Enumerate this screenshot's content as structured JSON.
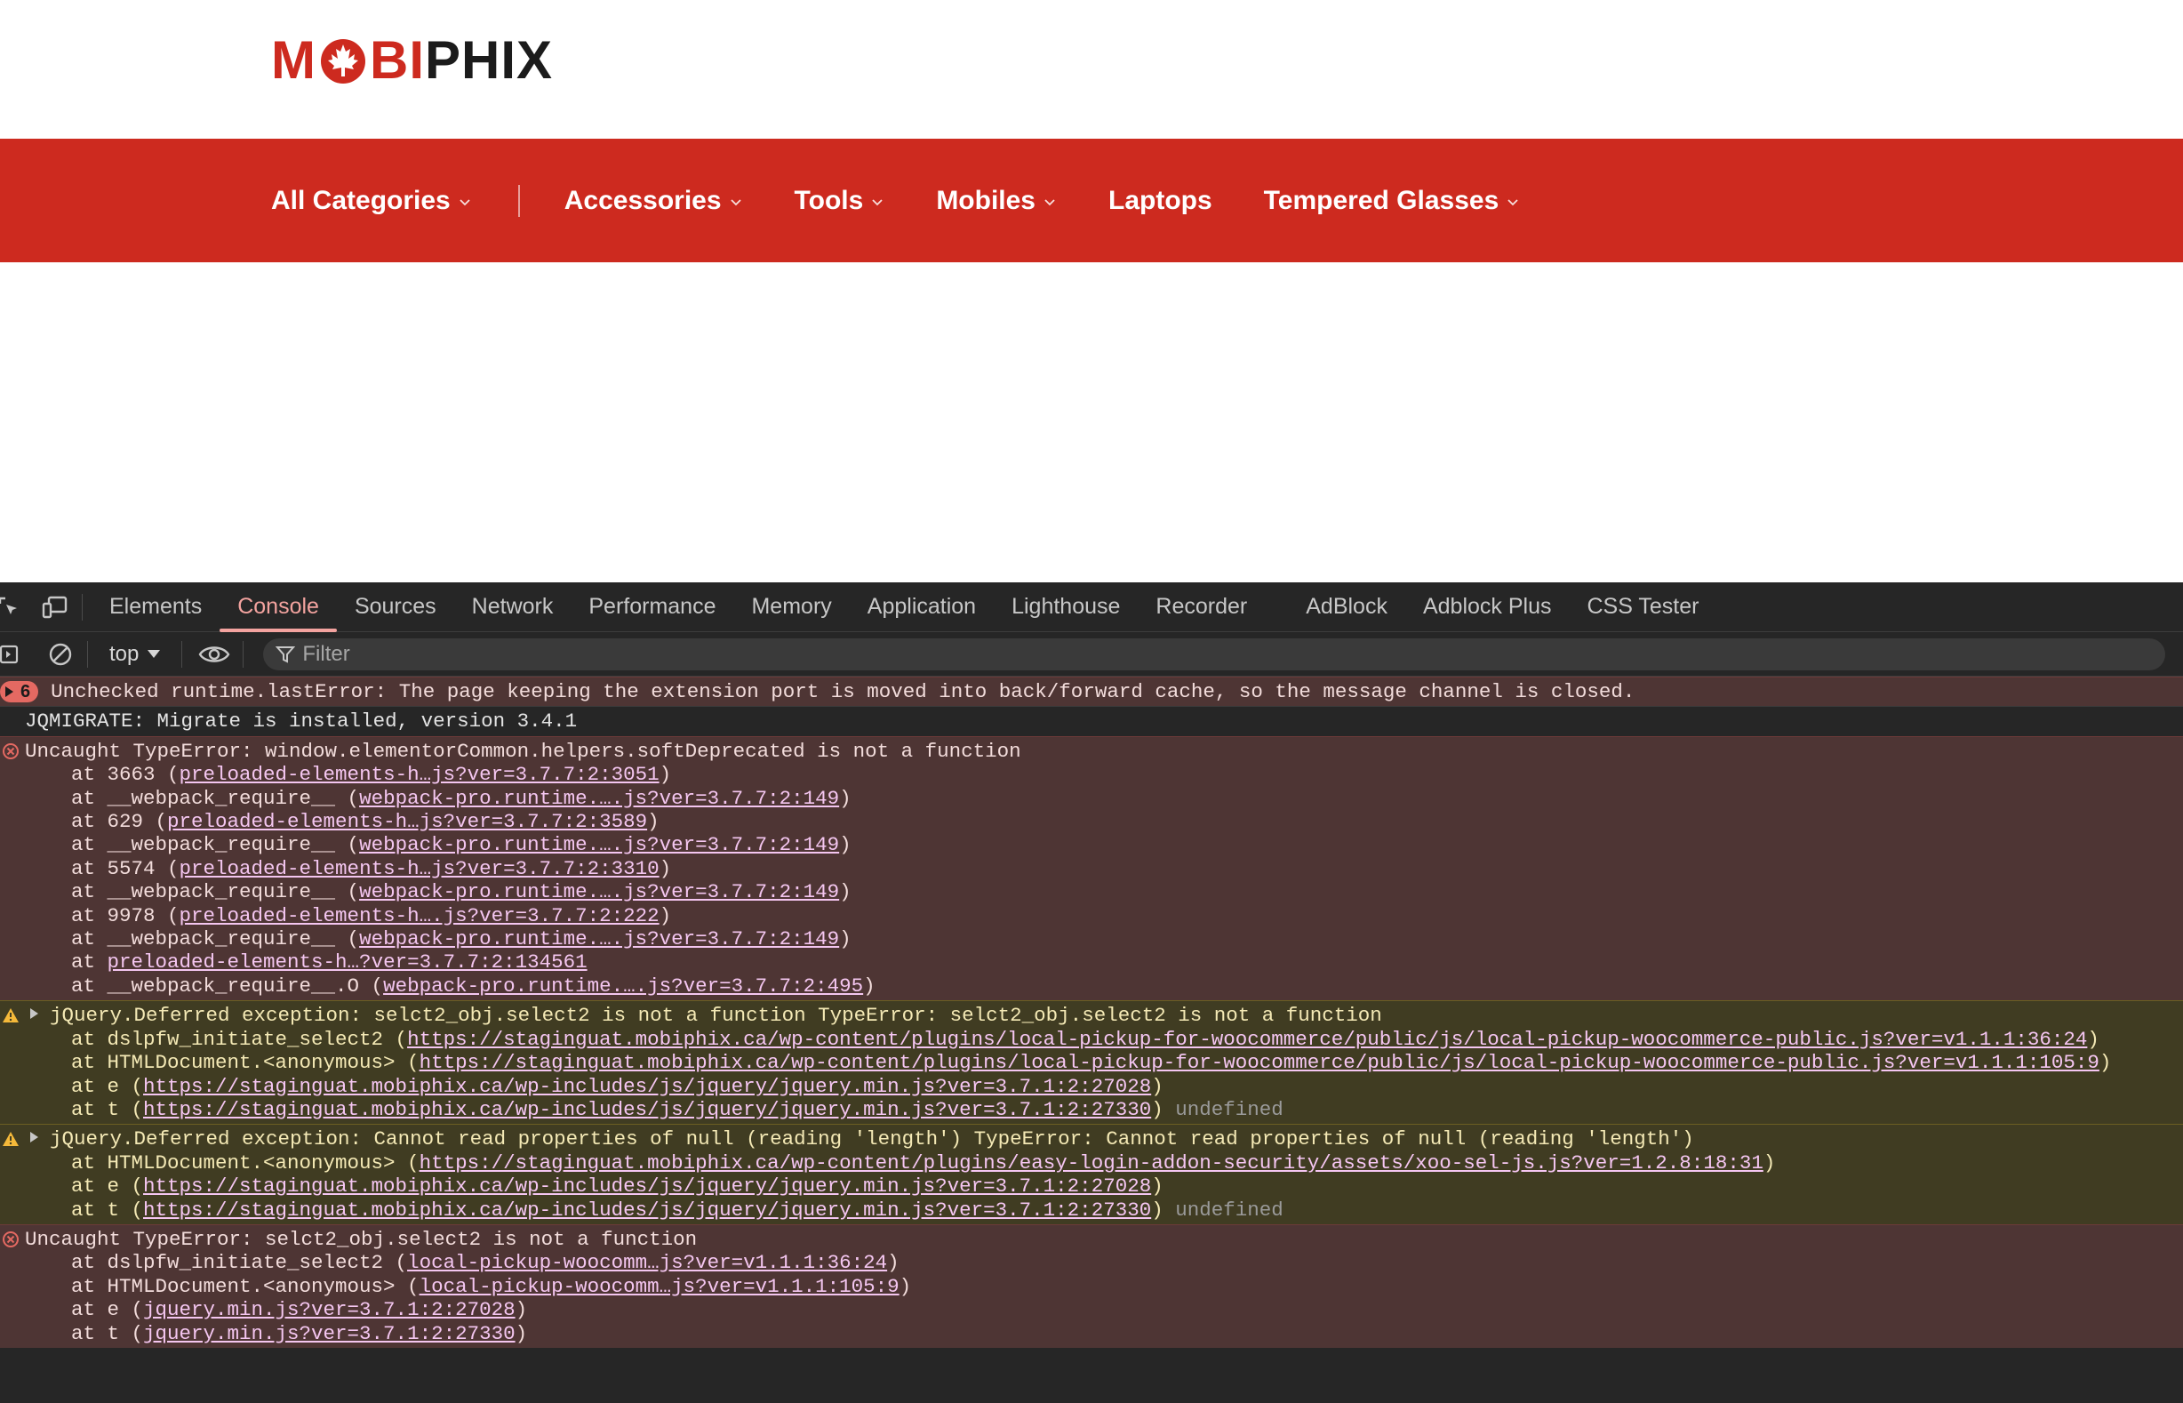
{
  "site": {
    "logo": {
      "part1": "M",
      "part2": "BI",
      "part3": "PHIX"
    },
    "nav": [
      {
        "label": "All Categories",
        "dropdown": true
      },
      {
        "label": "Accessories",
        "dropdown": true
      },
      {
        "label": "Tools",
        "dropdown": true
      },
      {
        "label": "Mobiles",
        "dropdown": true
      },
      {
        "label": "Laptops",
        "dropdown": false
      },
      {
        "label": "Tempered Glasses",
        "dropdown": true
      }
    ],
    "colors": {
      "brand": "#cd2a1f",
      "logo_dark": "#1b1b1b"
    }
  },
  "devtools": {
    "tabs": [
      "Elements",
      "Console",
      "Sources",
      "Network",
      "Performance",
      "Memory",
      "Application",
      "Lighthouse",
      "Recorder",
      "AdBlock",
      "Adblock Plus",
      "CSS Tester"
    ],
    "active_tab": "Console",
    "context": "top",
    "filter_placeholder": "Filter",
    "icons": [
      "inspect-element-icon",
      "device-toolbar-icon",
      "sidebar-toggle-icon",
      "clear-console-icon",
      "eye-icon",
      "filter-icon"
    ],
    "messages": [
      {
        "level": "error",
        "count": "6",
        "lines": [
          [
            {
              "t": "Unchecked runtime.lastError: The page keeping the extension port is moved into back/forward cache, so the message channel is closed."
            }
          ]
        ]
      },
      {
        "level": "info",
        "lines": [
          [
            {
              "t": "JQMIGRATE: Migrate is installed, version 3.4.1"
            }
          ]
        ]
      },
      {
        "level": "error",
        "lines": [
          [
            {
              "t": "Uncaught TypeError: window.elementorCommon.helpers.softDeprecated is not a function"
            }
          ],
          [
            {
              "t": "at 3663 ("
            },
            {
              "t": "preloaded-elements-h…js?ver=3.7.7:2:3051",
              "link": true
            },
            {
              "t": ")"
            }
          ],
          [
            {
              "t": "at __webpack_require__ ("
            },
            {
              "t": "webpack-pro.runtime.….js?ver=3.7.7:2:149",
              "link": true
            },
            {
              "t": ")"
            }
          ],
          [
            {
              "t": "at 629 ("
            },
            {
              "t": "preloaded-elements-h…js?ver=3.7.7:2:3589",
              "link": true
            },
            {
              "t": ")"
            }
          ],
          [
            {
              "t": "at __webpack_require__ ("
            },
            {
              "t": "webpack-pro.runtime.….js?ver=3.7.7:2:149",
              "link": true
            },
            {
              "t": ")"
            }
          ],
          [
            {
              "t": "at 5574 ("
            },
            {
              "t": "preloaded-elements-h…js?ver=3.7.7:2:3310",
              "link": true
            },
            {
              "t": ")"
            }
          ],
          [
            {
              "t": "at __webpack_require__ ("
            },
            {
              "t": "webpack-pro.runtime.….js?ver=3.7.7:2:149",
              "link": true
            },
            {
              "t": ")"
            }
          ],
          [
            {
              "t": "at 9978 ("
            },
            {
              "t": "preloaded-elements-h….js?ver=3.7.7:2:222",
              "link": true
            },
            {
              "t": ")"
            }
          ],
          [
            {
              "t": "at __webpack_require__ ("
            },
            {
              "t": "webpack-pro.runtime.….js?ver=3.7.7:2:149",
              "link": true
            },
            {
              "t": ")"
            }
          ],
          [
            {
              "t": "at "
            },
            {
              "t": "preloaded-elements-h…?ver=3.7.7:2:134561",
              "link": true
            }
          ],
          [
            {
              "t": "at __webpack_require__.O ("
            },
            {
              "t": "webpack-pro.runtime.….js?ver=3.7.7:2:495",
              "link": true
            },
            {
              "t": ")"
            }
          ]
        ]
      },
      {
        "level": "warn",
        "expandable": true,
        "lines": [
          [
            {
              "t": "jQuery.Deferred exception: selct2_obj.select2 is not a function TypeError: selct2_obj.select2 is not a function"
            }
          ],
          [
            {
              "t": "at dslpfw_initiate_select2 ("
            },
            {
              "t": "https://staginguat.mobiphix.ca/wp-content/plugins/local-pickup-for-woocommerce/public/js/local-pickup-woocommerce-public.js?ver=v1.1.1:36:24",
              "link": true
            },
            {
              "t": ")"
            }
          ],
          [
            {
              "t": "at HTMLDocument.<anonymous> ("
            },
            {
              "t": "https://staginguat.mobiphix.ca/wp-content/plugins/local-pickup-for-woocommerce/public/js/local-pickup-woocommerce-public.js?ver=v1.1.1:105:9",
              "link": true
            },
            {
              "t": ")"
            }
          ],
          [
            {
              "t": "at e ("
            },
            {
              "t": "https://staginguat.mobiphix.ca/wp-includes/js/jquery/jquery.min.js?ver=3.7.1:2:27028",
              "link": true
            },
            {
              "t": ")"
            }
          ],
          [
            {
              "t": "at t ("
            },
            {
              "t": "https://staginguat.mobiphix.ca/wp-includes/js/jquery/jquery.min.js?ver=3.7.1:2:27330",
              "link": true
            },
            {
              "t": ")"
            },
            {
              "t": " undefined",
              "muted": true
            }
          ]
        ]
      },
      {
        "level": "warn",
        "expandable": true,
        "lines": [
          [
            {
              "t": "jQuery.Deferred exception: Cannot read properties of null (reading 'length') TypeError: Cannot read properties of null (reading 'length')"
            }
          ],
          [
            {
              "t": "at HTMLDocument.<anonymous> ("
            },
            {
              "t": "https://staginguat.mobiphix.ca/wp-content/plugins/easy-login-addon-security/assets/xoo-sel-js.js?ver=1.2.8:18:31",
              "link": true
            },
            {
              "t": ")"
            }
          ],
          [
            {
              "t": "at e ("
            },
            {
              "t": "https://staginguat.mobiphix.ca/wp-includes/js/jquery/jquery.min.js?ver=3.7.1:2:27028",
              "link": true
            },
            {
              "t": ")"
            }
          ],
          [
            {
              "t": "at t ("
            },
            {
              "t": "https://staginguat.mobiphix.ca/wp-includes/js/jquery/jquery.min.js?ver=3.7.1:2:27330",
              "link": true
            },
            {
              "t": ")"
            },
            {
              "t": " undefined",
              "muted": true
            }
          ]
        ]
      },
      {
        "level": "error",
        "lines": [
          [
            {
              "t": "Uncaught TypeError: selct2_obj.select2 is not a function"
            }
          ],
          [
            {
              "t": "at dslpfw_initiate_select2 ("
            },
            {
              "t": "local-pickup-woocomm…js?ver=v1.1.1:36:24",
              "link": true
            },
            {
              "t": ")"
            }
          ],
          [
            {
              "t": "at HTMLDocument.<anonymous> ("
            },
            {
              "t": "local-pickup-woocomm…js?ver=v1.1.1:105:9",
              "link": true
            },
            {
              "t": ")"
            }
          ],
          [
            {
              "t": "at e ("
            },
            {
              "t": "jquery.min.js?ver=3.7.1:2:27028",
              "link": true
            },
            {
              "t": ")"
            }
          ],
          [
            {
              "t": "at t ("
            },
            {
              "t": "jquery.min.js?ver=3.7.1:2:27330",
              "link": true
            },
            {
              "t": ")"
            }
          ]
        ]
      }
    ]
  }
}
